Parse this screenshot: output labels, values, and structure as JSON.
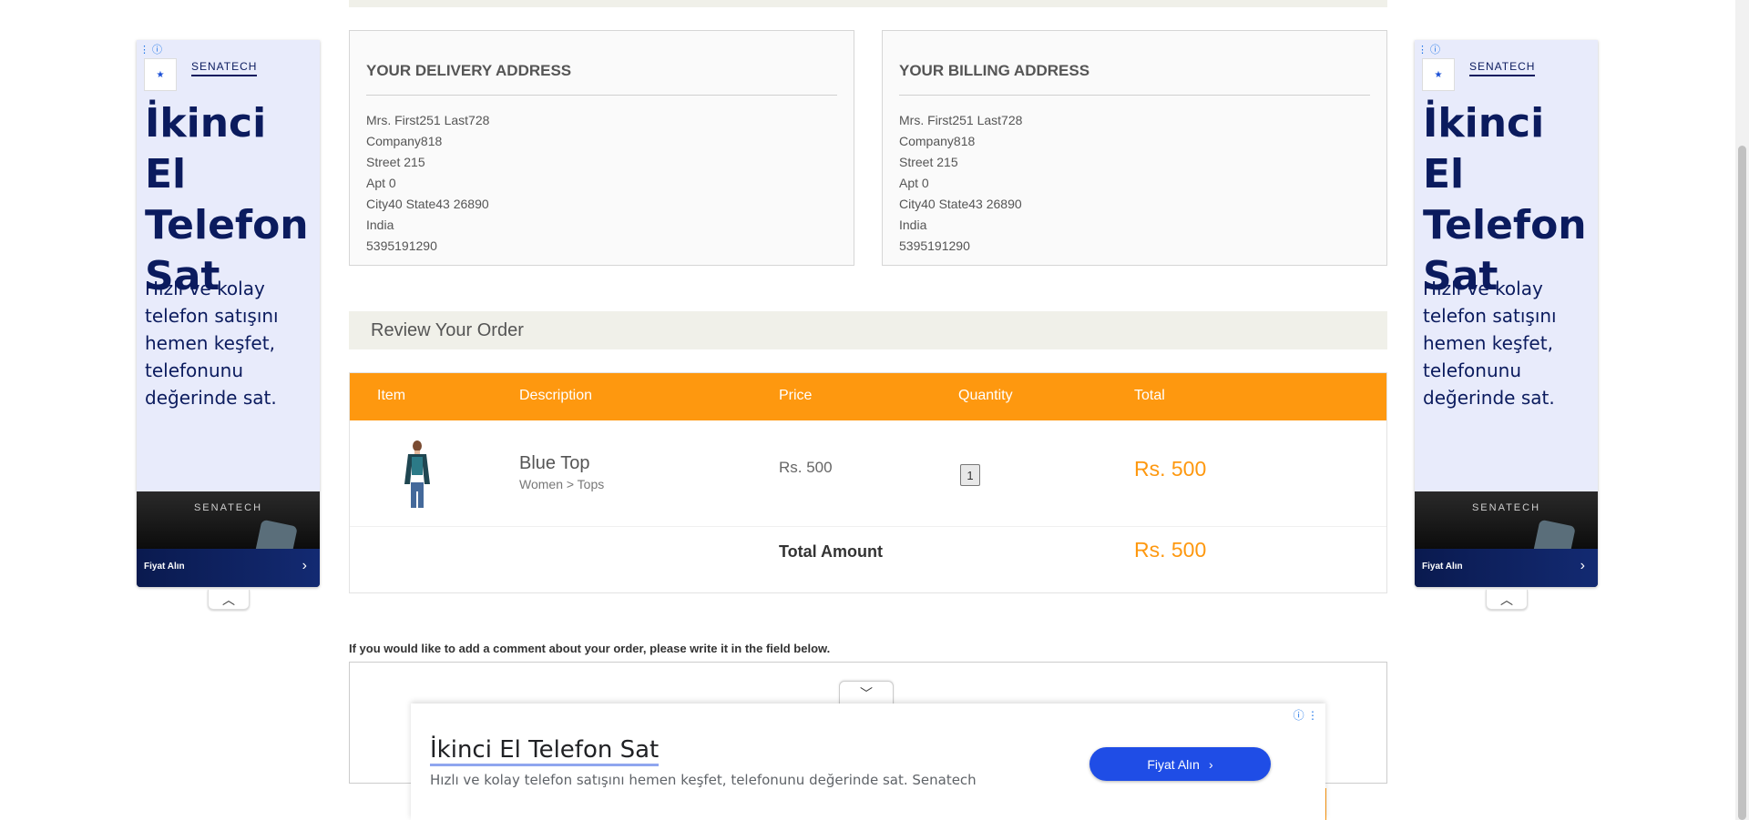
{
  "delivery": {
    "title": "YOUR DELIVERY ADDRESS",
    "name": "Mrs. First251 Last728",
    "company": "Company818",
    "street": "Street 215",
    "apt": "Apt 0",
    "city_state_zip": "City40 State43 26890",
    "country": "India",
    "phone": "5395191290"
  },
  "billing": {
    "title": "YOUR BILLING ADDRESS",
    "name": "Mrs. First251 Last728",
    "company": "Company818",
    "street": "Street 215",
    "apt": "Apt 0",
    "city_state_zip": "City40 State43 26890",
    "country": "India",
    "phone": "5395191290"
  },
  "review": {
    "heading": "Review Your Order",
    "columns": {
      "item": "Item",
      "description": "Description",
      "price": "Price",
      "quantity": "Quantity",
      "total": "Total"
    },
    "product": {
      "name": "Blue Top",
      "category": "Women > Tops",
      "price": "Rs. 500",
      "quantity": "1",
      "total": "Rs. 500"
    },
    "total_label": "Total Amount",
    "total_amount": "Rs. 500"
  },
  "comment": {
    "label": "If you would like to add a comment about your order, please write it in the field below."
  },
  "side_ad": {
    "brand": "SENATECH",
    "headline": "İkinci El Telefon Sat",
    "description": "Hızlı ve kolay telefon satışını hemen keşfet, telefonunu değerinde sat.",
    "banner_brand": "SENATECH",
    "cta": "Fiyat Alın"
  },
  "anchor_ad": {
    "title": "İkinci El Telefon Sat",
    "description": "Hızlı ve kolay telefon satışını hemen keşfet, telefonunu değerinde sat. Senatech",
    "cta": "Fiyat Alın"
  },
  "colors": {
    "accent": "#fe980f",
    "ad_navy": "#0b1b5e",
    "ad_button": "#1f4de6"
  }
}
